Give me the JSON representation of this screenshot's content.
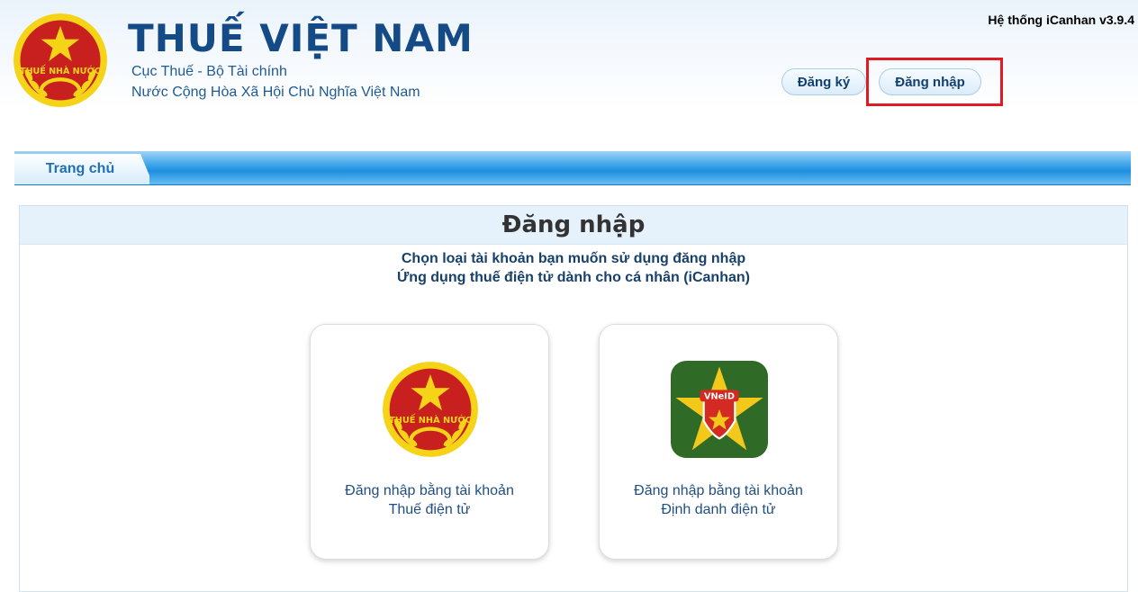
{
  "header": {
    "title": "THUẾ VIỆT NAM",
    "subtitle1": "Cục Thuế - Bộ Tài chính",
    "subtitle2": "Nước Cộng Hòa Xã Hội Chủ Nghĩa Việt Nam",
    "version": "Hệ thống iCanhan v3.9.4",
    "logo_text": "THUẾ NHÀ NƯỚC",
    "register_label": "Đăng ký",
    "login_label": "Đăng nhập"
  },
  "nav": {
    "home_label": "Trang chủ"
  },
  "main": {
    "title": "Đăng nhập",
    "line1": "Chọn loại tài khoản bạn muốn sử dụng đăng nhập",
    "line2": "Ứng dụng thuế điện tử dành cho cá nhân (iCanhan)",
    "options": [
      {
        "label1": "Đăng nhập bằng tài khoản",
        "label2": "Thuế điện tử",
        "icon": "tax-emblem-icon",
        "icon_text": "THUẾ NHÀ NƯỚC"
      },
      {
        "label1": "Đăng nhập bằng tài khoản",
        "label2": "Định danh điện tử",
        "icon": "vneid-icon",
        "icon_text": "VNeID"
      }
    ]
  },
  "colors": {
    "brand_blue": "#144a86",
    "emblem_red": "#c8201f",
    "emblem_gold": "#f5d418",
    "highlight_red": "#e01b24",
    "vneid_green": "#2f6a26"
  }
}
